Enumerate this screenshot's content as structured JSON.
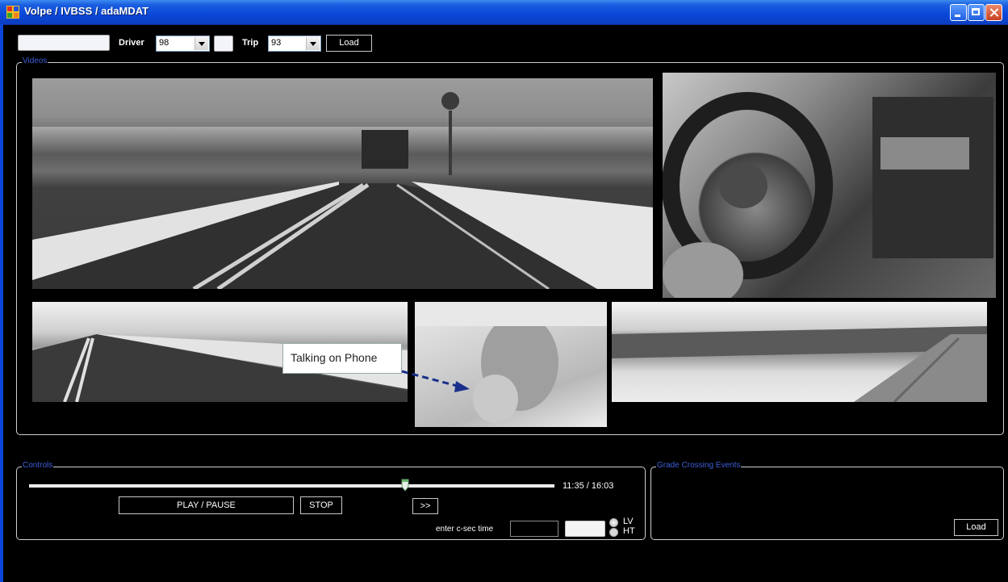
{
  "window": {
    "title": "Volpe / IVBSS / adaMDAT"
  },
  "toolbar": {
    "driver_label": "Driver",
    "driver_value": "98",
    "trip_label": "Trip",
    "trip_value": "93",
    "load_label": "Load"
  },
  "videos": {
    "group_title": "Videos",
    "annotation": "Talking on Phone"
  },
  "controls": {
    "group_title": "Controls",
    "play_pause_label": "PLAY / PAUSE",
    "stop_label": "STOP",
    "forward_label": ">>",
    "time_readout": "11:35 / 16:03",
    "progress_fraction": 0.71,
    "csec_label": "enter c-sec time",
    "radio_lv": "LV",
    "radio_ht": "HT",
    "selected_radio": "LV"
  },
  "grade_crossing": {
    "group_title": "Grade Crossing Events",
    "load_label": "Load"
  },
  "colors": {
    "titlebar_blue": "#0a47d8",
    "group_title_blue": "#3d5fd8",
    "annotation_arrow": "#1a2f8a"
  }
}
